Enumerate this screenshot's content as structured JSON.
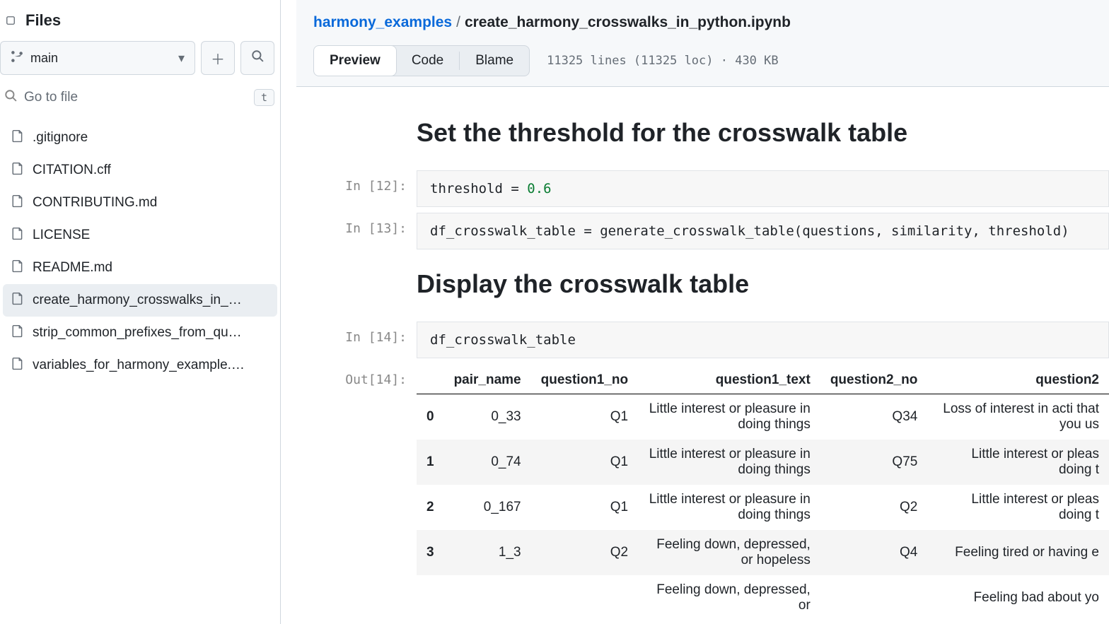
{
  "sidebar": {
    "title": "Files",
    "branch": "main",
    "gotofile_placeholder": "Go to file",
    "gotofile_kbd": "t",
    "files": [
      {
        "name": ".gitignore",
        "selected": false
      },
      {
        "name": "CITATION.cff",
        "selected": false
      },
      {
        "name": "CONTRIBUTING.md",
        "selected": false
      },
      {
        "name": "LICENSE",
        "selected": false
      },
      {
        "name": "README.md",
        "selected": false
      },
      {
        "name": "create_harmony_crosswalks_in_…",
        "selected": true
      },
      {
        "name": "strip_common_prefixes_from_qu…",
        "selected": false
      },
      {
        "name": "variables_for_harmony_example.…",
        "selected": false
      }
    ]
  },
  "breadcrumb": {
    "repo": "harmony_examples",
    "file": "create_harmony_crosswalks_in_python.ipynb"
  },
  "viewbar": {
    "preview": "Preview",
    "code": "Code",
    "blame": "Blame",
    "stats": "11325 lines (11325 loc) · 430 KB"
  },
  "notebook": {
    "h_threshold": "Set the threshold for the crosswalk table",
    "h_display": "Display the crosswalk table",
    "in12_prompt": "In [12]:",
    "in12_pre": "threshold = ",
    "in12_num": "0.6",
    "in13_prompt": "In [13]:",
    "in13_code": "df_crosswalk_table = generate_crosswalk_table(questions, similarity, threshold)",
    "in14_prompt": "In [14]:",
    "in14_code": "df_crosswalk_table",
    "out14_prompt": "Out[14]:",
    "table": {
      "headers": [
        "",
        "pair_name",
        "question1_no",
        "question1_text",
        "question2_no",
        "question2"
      ],
      "rows": [
        {
          "idx": "0",
          "pair": "0_33",
          "q1no": "Q1",
          "q1t": "Little interest or pleasure in doing things",
          "q2no": "Q34",
          "q2t": "Loss of interest in acti that you us"
        },
        {
          "idx": "1",
          "pair": "0_74",
          "q1no": "Q1",
          "q1t": "Little interest or pleasure in doing things",
          "q2no": "Q75",
          "q2t": "Little interest or pleas doing t"
        },
        {
          "idx": "2",
          "pair": "0_167",
          "q1no": "Q1",
          "q1t": "Little interest or pleasure in doing things",
          "q2no": "Q2",
          "q2t": "Little interest or pleas doing t"
        },
        {
          "idx": "3",
          "pair": "1_3",
          "q1no": "Q2",
          "q1t": "Feeling down, depressed, or hopeless",
          "q2no": "Q4",
          "q2t": "Feeling tired or having e"
        },
        {
          "idx": "",
          "pair": "",
          "q1no": "",
          "q1t": "Feeling down, depressed, or",
          "q2no": "",
          "q2t": "Feeling bad about yo"
        }
      ]
    }
  }
}
